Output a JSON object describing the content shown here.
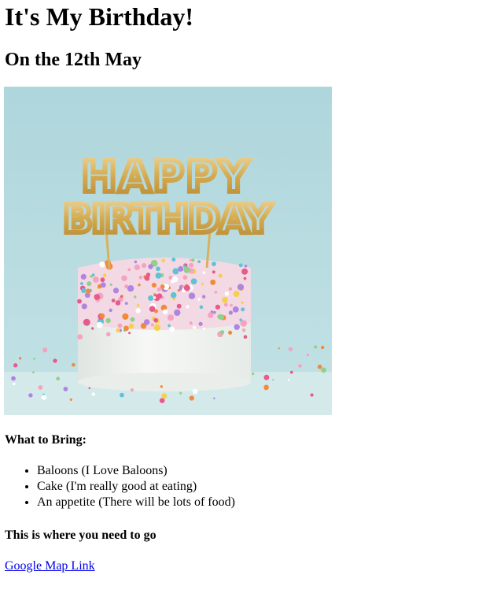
{
  "page": {
    "title": "It's My Birthday!",
    "subtitle": "On the 12th May"
  },
  "hero_image": {
    "topper_line1": "HAPPY",
    "topper_line2": "BIRTHDAY",
    "colors": {
      "background": "#b4d9de",
      "table": "#c9e3e4",
      "frosting": "#f2f4f1",
      "gold": "#d9b15c"
    }
  },
  "bring": {
    "heading": "What to Bring:",
    "items": [
      "Baloons (I Love Baloons)",
      "Cake (I'm really good at eating)",
      "An appetite (There will be lots of food)"
    ]
  },
  "directions": {
    "heading": "This is where you need to go",
    "link_text": "Google Map Link",
    "link_color": "#0000ee"
  }
}
